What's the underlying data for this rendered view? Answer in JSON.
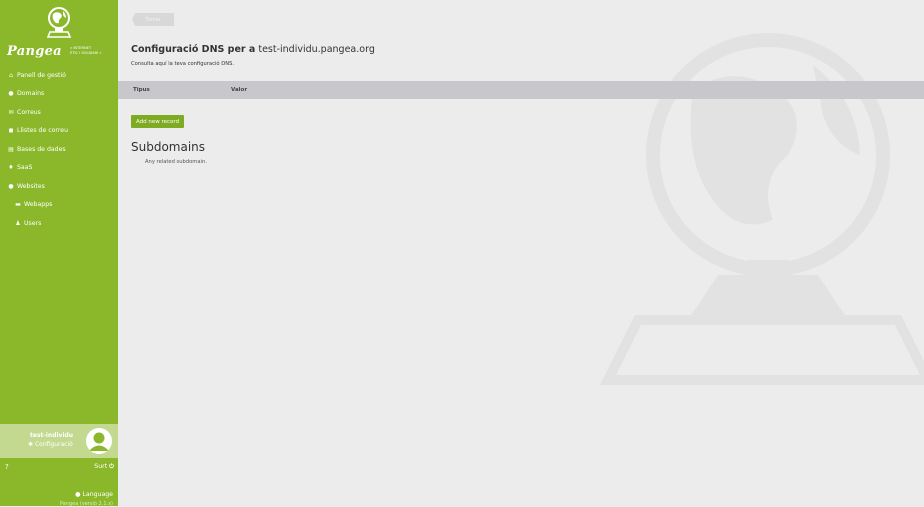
{
  "brand": {
    "logo_text": "Pangea",
    "tagline_1": "« INTERNET",
    "tagline_2": "ÈTIC I SOLIDARI »",
    "logo_icon": "globe-computer-icon"
  },
  "sidebar": {
    "items": [
      {
        "icon": "home-icon",
        "glyph": "⌂",
        "label": "Panell de gestió"
      },
      {
        "icon": "globe-icon",
        "glyph": "●",
        "label": "Domains"
      },
      {
        "icon": "mail-icon",
        "glyph": "✉",
        "label": "Correus"
      },
      {
        "icon": "users-icon",
        "glyph": "◼",
        "label": "Llistes de correu"
      },
      {
        "icon": "database-icon",
        "glyph": "▤",
        "label": "Bases de dades"
      },
      {
        "icon": "flame-icon",
        "glyph": "♦",
        "label": "SaaS"
      },
      {
        "icon": "globe-icon",
        "glyph": "●",
        "label": "Websites"
      },
      {
        "icon": "folder-icon",
        "glyph": "▬",
        "label": "Webapps"
      },
      {
        "icon": "user-icon",
        "glyph": "♟",
        "label": "Users"
      }
    ],
    "user": {
      "name": "test-individu",
      "config_label": "Configuració",
      "config_icon": "gear-icon"
    },
    "help_icon": "question-circle-icon",
    "logout_label": "Surt",
    "logout_icon": "power-icon",
    "language_label": "Language",
    "language_icon": "globe-icon",
    "version": "Pangea (versió 2.1.x)"
  },
  "main": {
    "back_label": "Tornar",
    "title_bold": "Configuració DNS per a",
    "title_domain": " test-individu.pangea.org",
    "subtitle": "Consulta aquí la teva configuració DNS.",
    "table": {
      "columns": [
        "Tipus",
        "Valor"
      ],
      "rows": []
    },
    "add_record_label": "Add new record",
    "subdomains_title": "Subdomains",
    "subdomains_desc": "Any related subdomain."
  },
  "colors": {
    "sidebar": "#8ab82a",
    "accent_button": "#7eab22",
    "table_header": "#c8c8cc",
    "background": "#ececec"
  }
}
